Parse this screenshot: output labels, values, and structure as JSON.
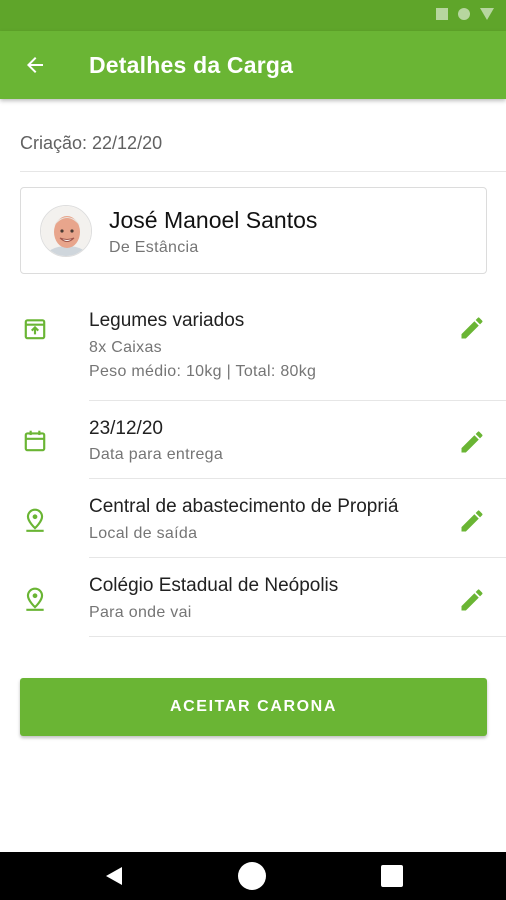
{
  "colors": {
    "primary": "#6ab534",
    "status_bar": "#5fa52a",
    "icon_green": "#6ab534"
  },
  "app_bar": {
    "title": "Detalhes da Carga",
    "back_icon": "arrow-back-icon"
  },
  "created": {
    "text": "Criação: 22/12/20"
  },
  "user": {
    "name": "José Manoel Santos",
    "origin": "De Estância",
    "avatar_icon": "avatar"
  },
  "details": [
    {
      "icon": "archive-box-icon",
      "title": "Legumes variados",
      "subtitle": "8x Caixas",
      "subtitle2": "Peso médio: 10kg | Total: 80kg"
    },
    {
      "icon": "calendar-icon",
      "title": "23/12/20",
      "subtitle": "Data para entrega"
    },
    {
      "icon": "location-pin-icon",
      "title": "Central de abastecimento de Propriá",
      "subtitle": "Local de saída"
    },
    {
      "icon": "location-pin-icon",
      "title": "Colégio Estadual de Neópolis",
      "subtitle": "Para onde vai"
    }
  ],
  "actions": {
    "accept_label": "ACEITAR CARONA"
  },
  "nav_bar": {
    "back_icon": "nav-back-icon",
    "home_icon": "nav-home-icon",
    "recent_icon": "nav-recent-icon"
  }
}
